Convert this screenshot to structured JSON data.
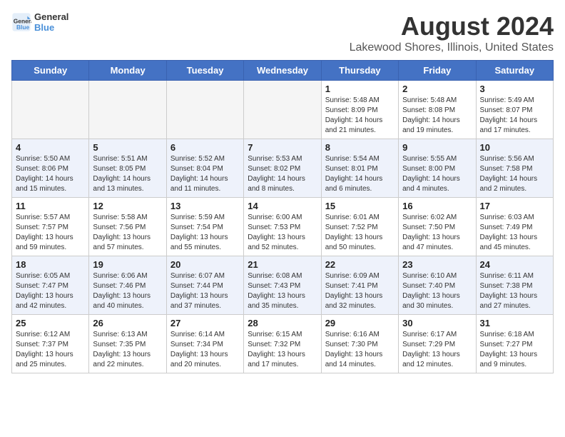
{
  "header": {
    "logo_line1": "General",
    "logo_line2": "Blue",
    "title": "August 2024",
    "subtitle": "Lakewood Shores, Illinois, United States"
  },
  "weekdays": [
    "Sunday",
    "Monday",
    "Tuesday",
    "Wednesday",
    "Thursday",
    "Friday",
    "Saturday"
  ],
  "weeks": [
    [
      {
        "day": "",
        "info": ""
      },
      {
        "day": "",
        "info": ""
      },
      {
        "day": "",
        "info": ""
      },
      {
        "day": "",
        "info": ""
      },
      {
        "day": "1",
        "info": "Sunrise: 5:48 AM\nSunset: 8:09 PM\nDaylight: 14 hours\nand 21 minutes."
      },
      {
        "day": "2",
        "info": "Sunrise: 5:48 AM\nSunset: 8:08 PM\nDaylight: 14 hours\nand 19 minutes."
      },
      {
        "day": "3",
        "info": "Sunrise: 5:49 AM\nSunset: 8:07 PM\nDaylight: 14 hours\nand 17 minutes."
      }
    ],
    [
      {
        "day": "4",
        "info": "Sunrise: 5:50 AM\nSunset: 8:06 PM\nDaylight: 14 hours\nand 15 minutes."
      },
      {
        "day": "5",
        "info": "Sunrise: 5:51 AM\nSunset: 8:05 PM\nDaylight: 14 hours\nand 13 minutes."
      },
      {
        "day": "6",
        "info": "Sunrise: 5:52 AM\nSunset: 8:04 PM\nDaylight: 14 hours\nand 11 minutes."
      },
      {
        "day": "7",
        "info": "Sunrise: 5:53 AM\nSunset: 8:02 PM\nDaylight: 14 hours\nand 8 minutes."
      },
      {
        "day": "8",
        "info": "Sunrise: 5:54 AM\nSunset: 8:01 PM\nDaylight: 14 hours\nand 6 minutes."
      },
      {
        "day": "9",
        "info": "Sunrise: 5:55 AM\nSunset: 8:00 PM\nDaylight: 14 hours\nand 4 minutes."
      },
      {
        "day": "10",
        "info": "Sunrise: 5:56 AM\nSunset: 7:58 PM\nDaylight: 14 hours\nand 2 minutes."
      }
    ],
    [
      {
        "day": "11",
        "info": "Sunrise: 5:57 AM\nSunset: 7:57 PM\nDaylight: 13 hours\nand 59 minutes."
      },
      {
        "day": "12",
        "info": "Sunrise: 5:58 AM\nSunset: 7:56 PM\nDaylight: 13 hours\nand 57 minutes."
      },
      {
        "day": "13",
        "info": "Sunrise: 5:59 AM\nSunset: 7:54 PM\nDaylight: 13 hours\nand 55 minutes."
      },
      {
        "day": "14",
        "info": "Sunrise: 6:00 AM\nSunset: 7:53 PM\nDaylight: 13 hours\nand 52 minutes."
      },
      {
        "day": "15",
        "info": "Sunrise: 6:01 AM\nSunset: 7:52 PM\nDaylight: 13 hours\nand 50 minutes."
      },
      {
        "day": "16",
        "info": "Sunrise: 6:02 AM\nSunset: 7:50 PM\nDaylight: 13 hours\nand 47 minutes."
      },
      {
        "day": "17",
        "info": "Sunrise: 6:03 AM\nSunset: 7:49 PM\nDaylight: 13 hours\nand 45 minutes."
      }
    ],
    [
      {
        "day": "18",
        "info": "Sunrise: 6:05 AM\nSunset: 7:47 PM\nDaylight: 13 hours\nand 42 minutes."
      },
      {
        "day": "19",
        "info": "Sunrise: 6:06 AM\nSunset: 7:46 PM\nDaylight: 13 hours\nand 40 minutes."
      },
      {
        "day": "20",
        "info": "Sunrise: 6:07 AM\nSunset: 7:44 PM\nDaylight: 13 hours\nand 37 minutes."
      },
      {
        "day": "21",
        "info": "Sunrise: 6:08 AM\nSunset: 7:43 PM\nDaylight: 13 hours\nand 35 minutes."
      },
      {
        "day": "22",
        "info": "Sunrise: 6:09 AM\nSunset: 7:41 PM\nDaylight: 13 hours\nand 32 minutes."
      },
      {
        "day": "23",
        "info": "Sunrise: 6:10 AM\nSunset: 7:40 PM\nDaylight: 13 hours\nand 30 minutes."
      },
      {
        "day": "24",
        "info": "Sunrise: 6:11 AM\nSunset: 7:38 PM\nDaylight: 13 hours\nand 27 minutes."
      }
    ],
    [
      {
        "day": "25",
        "info": "Sunrise: 6:12 AM\nSunset: 7:37 PM\nDaylight: 13 hours\nand 25 minutes."
      },
      {
        "day": "26",
        "info": "Sunrise: 6:13 AM\nSunset: 7:35 PM\nDaylight: 13 hours\nand 22 minutes."
      },
      {
        "day": "27",
        "info": "Sunrise: 6:14 AM\nSunset: 7:34 PM\nDaylight: 13 hours\nand 20 minutes."
      },
      {
        "day": "28",
        "info": "Sunrise: 6:15 AM\nSunset: 7:32 PM\nDaylight: 13 hours\nand 17 minutes."
      },
      {
        "day": "29",
        "info": "Sunrise: 6:16 AM\nSunset: 7:30 PM\nDaylight: 13 hours\nand 14 minutes."
      },
      {
        "day": "30",
        "info": "Sunrise: 6:17 AM\nSunset: 7:29 PM\nDaylight: 13 hours\nand 12 minutes."
      },
      {
        "day": "31",
        "info": "Sunrise: 6:18 AM\nSunset: 7:27 PM\nDaylight: 13 hours\nand 9 minutes."
      }
    ]
  ]
}
